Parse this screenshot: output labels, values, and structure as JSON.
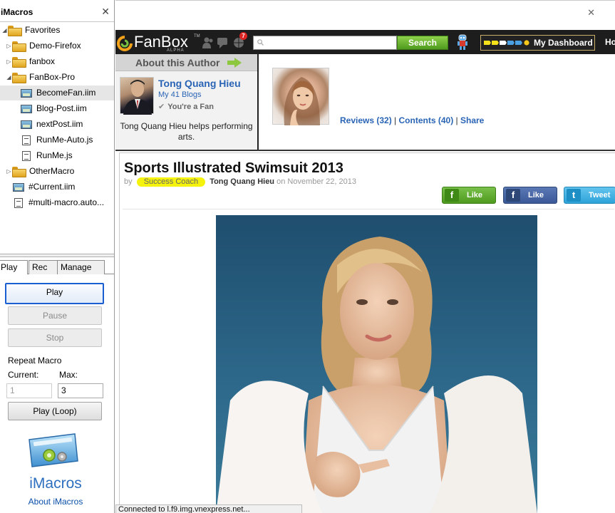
{
  "sidebar": {
    "title": "iMacros",
    "tree": [
      {
        "label": "Favorites",
        "type": "folder",
        "state": "open"
      },
      {
        "label": "Demo-Firefox",
        "type": "folder",
        "state": "closed"
      },
      {
        "label": "fanbox",
        "type": "folder",
        "state": "closed"
      },
      {
        "label": "FanBox-Pro",
        "type": "folder",
        "state": "open"
      },
      {
        "label": "BecomeFan.iim",
        "type": "iim",
        "selected": true
      },
      {
        "label": "Blog-Post.iim",
        "type": "iim"
      },
      {
        "label": "nextPost.iim",
        "type": "iim"
      },
      {
        "label": "RunMe-Auto.js",
        "type": "js"
      },
      {
        "label": "RunMe.js",
        "type": "js"
      },
      {
        "label": "OtherMacro",
        "type": "folder",
        "state": "closed"
      },
      {
        "label": "#Current.iim",
        "type": "iim"
      },
      {
        "label": "#multi-macro.auto...",
        "type": "js"
      }
    ],
    "tabs": [
      "Play",
      "Rec",
      "Manage"
    ],
    "active_tab": "Play",
    "buttons": {
      "play": "Play",
      "pause": "Pause",
      "stop": "Stop",
      "play_loop": "Play (Loop)"
    },
    "repeat": {
      "title": "Repeat Macro",
      "current_label": "Current:",
      "max_label": "Max:",
      "current_value": "1",
      "max_value": "3"
    },
    "logo_text": "iMacros",
    "about_link": "About iMacros"
  },
  "browser": {
    "status_text": "Connected to l.f9.img.vnexpress.net..."
  },
  "fanbox": {
    "logo": "FanBox",
    "logo_tag": "ALPHA",
    "logo_tm": "TM",
    "notification_count": "7",
    "search_placeholder": "",
    "search_button": "Search",
    "dashboard_label": "My Dashboard",
    "home_label": "Ho"
  },
  "author": {
    "heading": "About this Author",
    "name": "Tong Quang Hieu",
    "blogs": "My 41 Blogs",
    "fan_status": "You're a Fan",
    "bio": "Tong Quang Hieu helps performing arts."
  },
  "profile": {
    "reviews": "Reviews (32)",
    "contents": "Contents (40)",
    "share": "Share",
    "sep": "|"
  },
  "post": {
    "title": "Sports Illustrated Swimsuit 2013",
    "by": "by",
    "tag": "Success Coach",
    "author": "Tong Quang Hieu",
    "date": "on November 22, 2013",
    "share_buttons": [
      {
        "label": "Like",
        "icon": "f",
        "color": "#5aa229"
      },
      {
        "label": "Like",
        "icon": "f",
        "color": "#3b5998"
      },
      {
        "label": "Tweet",
        "icon": "t",
        "color": "#3aaee3"
      }
    ]
  },
  "colors": {
    "link_blue": "#2a64b5",
    "fanbox_green": "#7ac142",
    "tag_yellow": "#f5f20b",
    "focus_blue": "#1a5fd1"
  }
}
